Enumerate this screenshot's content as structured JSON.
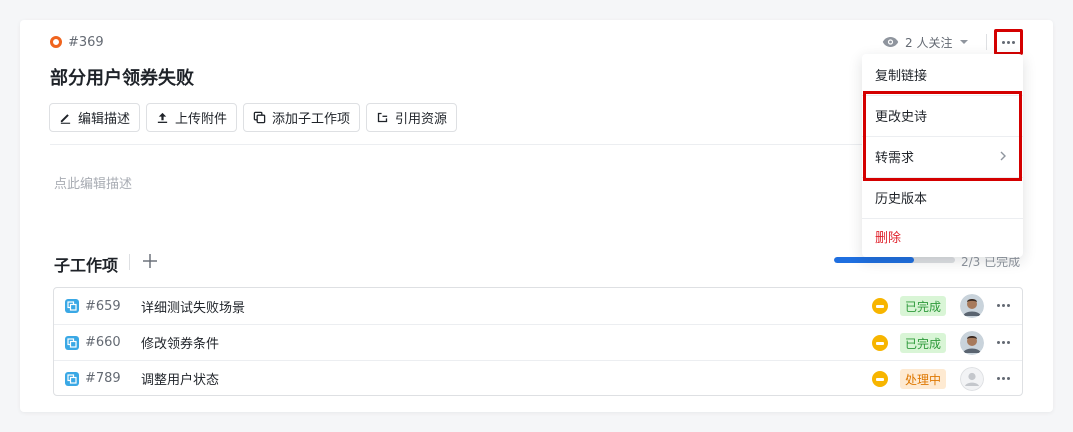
{
  "issue": {
    "id": "#369",
    "title": "部分用户领券失败",
    "status_color": "#f0641e"
  },
  "toolbar": {
    "edit_desc": "编辑描述",
    "upload": "上传附件",
    "add_subtask": "添加子工作项",
    "cite": "引用资源"
  },
  "description": {
    "placeholder": "点此编辑描述"
  },
  "header": {
    "watchers_label": "2 人关注"
  },
  "menu": {
    "copy_link": "复制链接",
    "change_epic": "更改史诗",
    "to_requirement": "转需求",
    "history": "历史版本",
    "delete": "删除"
  },
  "subtasks": {
    "title": "子工作项",
    "progress_text": "2/3 已完成",
    "progress": 0.66,
    "items": [
      {
        "id": "#659",
        "title": "详细测试失败场景",
        "status": "已完成",
        "state": "done",
        "avatar": "person"
      },
      {
        "id": "#660",
        "title": "修改领券条件",
        "status": "已完成",
        "state": "done",
        "avatar": "person"
      },
      {
        "id": "#789",
        "title": "调整用户状态",
        "status": "处理中",
        "state": "doing",
        "avatar": "empty"
      }
    ]
  },
  "colors": {
    "accent": "#1f6fe0",
    "priority": "#f7b500",
    "danger": "#e0222c",
    "highlight": "#d40000"
  }
}
